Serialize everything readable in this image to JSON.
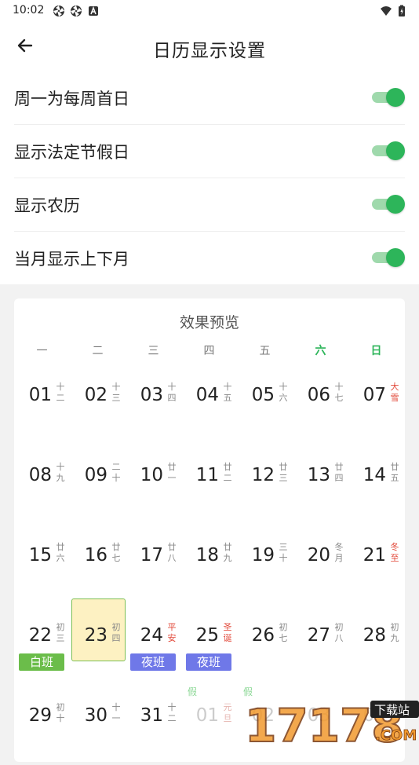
{
  "status_bar": {
    "time": "10:02",
    "left_icons": [
      "aperture-icon",
      "aperture-icon",
      "notification-a-icon"
    ],
    "right_icons": [
      "wifi-icon",
      "battery-icon"
    ]
  },
  "header": {
    "back_icon": "arrow-left-icon",
    "title": "日历显示设置"
  },
  "settings": [
    {
      "label": "周一为每周首日",
      "enabled": true
    },
    {
      "label": "显示法定节假日",
      "enabled": true
    },
    {
      "label": "显示农历",
      "enabled": true
    },
    {
      "label": "当月显示上下月",
      "enabled": true
    }
  ],
  "colors": {
    "accent_green": "#2db55a",
    "toggle_track": "#9fd9ac",
    "festival_red": "#e24a3b",
    "day_shift": "#6bbd4a",
    "night_shift": "#6f78e8",
    "selected_bg": "#fdf1c2"
  },
  "preview": {
    "title": "效果预览",
    "weekdays": [
      {
        "label": "一",
        "weekend": false
      },
      {
        "label": "二",
        "weekend": false
      },
      {
        "label": "三",
        "weekend": false
      },
      {
        "label": "四",
        "weekend": false
      },
      {
        "label": "五",
        "weekend": false
      },
      {
        "label": "六",
        "weekend": true
      },
      {
        "label": "日",
        "weekend": true
      }
    ],
    "weeks": [
      [
        {
          "day": "01",
          "lunar": "十二"
        },
        {
          "day": "02",
          "lunar": "十三"
        },
        {
          "day": "03",
          "lunar": "十四"
        },
        {
          "day": "04",
          "lunar": "十五"
        },
        {
          "day": "05",
          "lunar": "十六"
        },
        {
          "day": "06",
          "lunar": "十七"
        },
        {
          "day": "07",
          "lunar": "大雪",
          "lunar_red": true
        }
      ],
      [
        {
          "day": "08",
          "lunar": "十九"
        },
        {
          "day": "09",
          "lunar": "二十"
        },
        {
          "day": "10",
          "lunar": "廿一"
        },
        {
          "day": "11",
          "lunar": "廿二"
        },
        {
          "day": "12",
          "lunar": "廿三"
        },
        {
          "day": "13",
          "lunar": "廿四"
        },
        {
          "day": "14",
          "lunar": "廿五"
        }
      ],
      [
        {
          "day": "15",
          "lunar": "廿六"
        },
        {
          "day": "16",
          "lunar": "廿七"
        },
        {
          "day": "17",
          "lunar": "廿八"
        },
        {
          "day": "18",
          "lunar": "廿九"
        },
        {
          "day": "19",
          "lunar": "三十"
        },
        {
          "day": "20",
          "lunar": "冬月"
        },
        {
          "day": "21",
          "lunar": "冬至",
          "lunar_red": true
        }
      ],
      [
        {
          "day": "22",
          "lunar": "初三",
          "shift": "白班",
          "shift_type": "day"
        },
        {
          "day": "23",
          "lunar": "初四",
          "selected": true
        },
        {
          "day": "24",
          "lunar": "平安",
          "lunar_red": true,
          "shift": "夜班",
          "shift_type": "night"
        },
        {
          "day": "25",
          "lunar": "圣诞",
          "lunar_red": true,
          "shift": "夜班",
          "shift_type": "night"
        },
        {
          "day": "26",
          "lunar": "初七"
        },
        {
          "day": "27",
          "lunar": "初八"
        },
        {
          "day": "28",
          "lunar": "初九"
        }
      ],
      [
        {
          "day": "29",
          "lunar": "初十"
        },
        {
          "day": "30",
          "lunar": "十一"
        },
        {
          "day": "31",
          "lunar": "十二"
        },
        {
          "day": "01",
          "lunar": "元旦",
          "lunar_red": true,
          "faded": true,
          "tag": "假"
        },
        {
          "day": "02",
          "lunar": "",
          "faded": true,
          "tag": "假"
        },
        {
          "day": "03",
          "lunar": "",
          "faded": true
        },
        {
          "day": "04",
          "lunar": "",
          "faded": true
        }
      ]
    ]
  },
  "watermark": {
    "number": "17178",
    "site": ".COM",
    "badge": "下载站"
  }
}
